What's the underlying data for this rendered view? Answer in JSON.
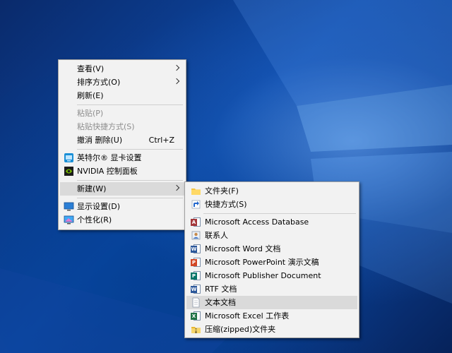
{
  "main_menu": {
    "items": [
      {
        "label": "查看(V)",
        "has_submenu": true
      },
      {
        "label": "排序方式(O)",
        "has_submenu": true
      },
      {
        "label": "刷新(E)"
      },
      {
        "label": "粘贴(P)",
        "disabled": true
      },
      {
        "label": "粘贴快捷方式(S)",
        "disabled": true
      },
      {
        "label": "撤消 删除(U)",
        "shortcut": "Ctrl+Z"
      },
      {
        "label": "英特尔® 显卡设置",
        "icon": "intel-graphics-icon"
      },
      {
        "label": "NVIDIA 控制面板",
        "icon": "nvidia-icon"
      },
      {
        "label": "新建(W)",
        "has_submenu": true,
        "highlighted": true
      },
      {
        "label": "显示设置(D)",
        "icon": "display-settings-icon"
      },
      {
        "label": "个性化(R)",
        "icon": "personalize-icon"
      }
    ]
  },
  "new_submenu": {
    "items": [
      {
        "label": "文件夹(F)",
        "icon": "folder-icon"
      },
      {
        "label": "快捷方式(S)",
        "icon": "shortcut-icon"
      },
      {
        "label": "Microsoft Access Database",
        "icon": "access-icon"
      },
      {
        "label": "联系人",
        "icon": "contact-icon"
      },
      {
        "label": "Microsoft Word 文档",
        "icon": "word-icon"
      },
      {
        "label": "Microsoft PowerPoint 演示文稿",
        "icon": "powerpoint-icon"
      },
      {
        "label": "Microsoft Publisher Document",
        "icon": "publisher-icon"
      },
      {
        "label": "RTF 文档",
        "icon": "rtf-icon"
      },
      {
        "label": "文本文档",
        "icon": "text-document-icon",
        "highlighted": true
      },
      {
        "label": "Microsoft Excel 工作表",
        "icon": "excel-icon"
      },
      {
        "label": "压缩(zipped)文件夹",
        "icon": "zip-folder-icon"
      }
    ]
  },
  "colors": {
    "menu_bg": "#f2f2f2",
    "highlight": "#dadada",
    "disabled_text": "#8d8d8d",
    "desktop_blue": "#0d4aa8"
  }
}
